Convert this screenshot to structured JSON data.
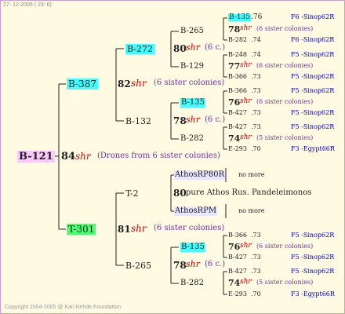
{
  "header": {
    "date": "27- 12-2005 ( 23: 6)"
  },
  "footer": {
    "copyright": "Copyright 2004-2005 @ Karl Kehde Foundation."
  },
  "root": {
    "id": "B-121",
    "num": "84",
    "shr": "shr",
    "note": "(Drones from 6 sister colonies)"
  },
  "father": {
    "id": "B-387",
    "num": "82",
    "shr": "shr",
    "note": "(6 sister colonies)"
  },
  "mother": {
    "id": "T-301",
    "num": "81",
    "shr": "shr",
    "note": "(6 sister colonies)"
  },
  "ff": {
    "id": "B-272",
    "num": "80",
    "shr": "shr",
    "note": "(6 c.)"
  },
  "fm": {
    "id": "B-132",
    "num": "78",
    "shr": "shr",
    "note": "(6 c.)"
  },
  "mf": {
    "id": "T-2",
    "num": "80",
    "text": "pure Athos Rus. Pandeleimonos"
  },
  "mm": {
    "id": "B-265",
    "num": "78",
    "shr": "shr",
    "note": "(6 c.)"
  },
  "fff": {
    "id": "B-265",
    "num": "78",
    "shr": "shr",
    "note": "(6 sister colonies)"
  },
  "ffm": {
    "id": "B-129",
    "num": "77",
    "shr": "shr",
    "note": "(6 sister colonies)"
  },
  "fmf": {
    "id": "B-135",
    "num": "76",
    "shr": "shr",
    "note": "(6 sister colonies)"
  },
  "fmm": {
    "id": "B-282",
    "num": "74",
    "shr": "shr",
    "note": "(5 sister colonies)"
  },
  "mff": {
    "id": "AthosRP80R",
    "note": "no more"
  },
  "mfm": {
    "id": "AthosRPM",
    "note": "no more"
  },
  "mmf": {
    "id": "B-135",
    "num": "76",
    "shr": "shr",
    "note": "(6 sister colonies)"
  },
  "mmm": {
    "id": "B-282",
    "num": "74",
    "shr": "shr",
    "note": "(5 sister colonies)"
  },
  "leaves": [
    {
      "id": "B-135",
      "val": ".76",
      "line": "F6 -Sinop62R"
    },
    {
      "id": "B-282",
      "val": ".74",
      "line": "F6 -Sinop62R"
    },
    {
      "id": "B-248",
      "val": ".74",
      "line": "F5 -Sinop62R"
    },
    {
      "id": "B-366",
      "val": ".73",
      "line": "F5 -Sinop62R"
    },
    {
      "id": "B-366",
      "val": ".73",
      "line": "F5 -Sinop62R"
    },
    {
      "id": "B-427",
      "val": ".73",
      "line": "F5 -Sinop62R"
    },
    {
      "id": "B-427",
      "val": ".73",
      "line": "F5 -Sinop62R"
    },
    {
      "id": "E-293",
      "val": ".70",
      "line": "F3 -Egypt66R"
    },
    {
      "id": "B-366",
      "val": ".73",
      "line": "F5 -Sinop62R"
    },
    {
      "id": "B-427",
      "val": ".73",
      "line": "F5 -Sinop62R"
    },
    {
      "id": "B-427",
      "val": ".73",
      "line": "F5 -Sinop62R"
    },
    {
      "id": "E-293",
      "val": ".70",
      "line": "F3 -Egypt66R"
    }
  ],
  "colors": {
    "cyan": "#40ffff",
    "magenta": "#ffc8ff",
    "green": "#48ff70",
    "red": "#cc0000",
    "blue": "#0000cc",
    "purple": "#7030a0"
  }
}
